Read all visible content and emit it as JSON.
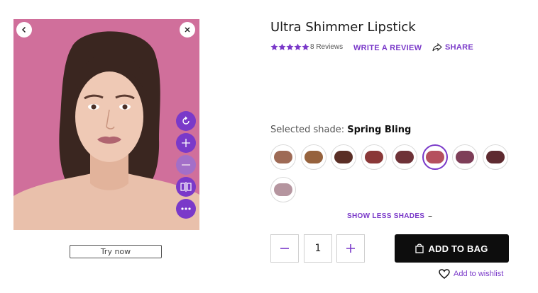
{
  "viewer": {
    "back_icon": "chevron-left-icon",
    "close_icon": "close-icon",
    "tools": [
      "reset-icon",
      "zoom-in-icon",
      "zoom-out-icon",
      "compare-icon",
      "more-icon"
    ],
    "try_now_label": "Try now"
  },
  "product": {
    "title": "Ultra Shimmer Lipstick",
    "rating": 5,
    "reviews_label": "8 Reviews",
    "write_review_label": "WRITE A REVIEW",
    "share_label": "SHARE"
  },
  "shades": {
    "selected_prefix": "Selected shade:",
    "selected_name": "Spring Bling",
    "swatches": [
      {
        "color": "#9e6a55"
      },
      {
        "color": "#96623d"
      },
      {
        "color": "#5a2e25"
      },
      {
        "color": "#8a3838"
      },
      {
        "color": "#6e3237"
      },
      {
        "color": "#b5505e",
        "selected": true
      },
      {
        "color": "#7e3e58"
      },
      {
        "color": "#5e2a30"
      },
      {
        "color": "#b5959f"
      }
    ],
    "show_less_label": "SHOW LESS SHADES",
    "show_less_icon": "–"
  },
  "purchase": {
    "quantity": "1",
    "add_to_bag_label": "ADD TO BAG",
    "wishlist_label": "Add to wishlist"
  },
  "colors": {
    "accent": "#7a39c9",
    "bag_button": "#0d0d0d",
    "photo_background": "#d06f9b"
  }
}
